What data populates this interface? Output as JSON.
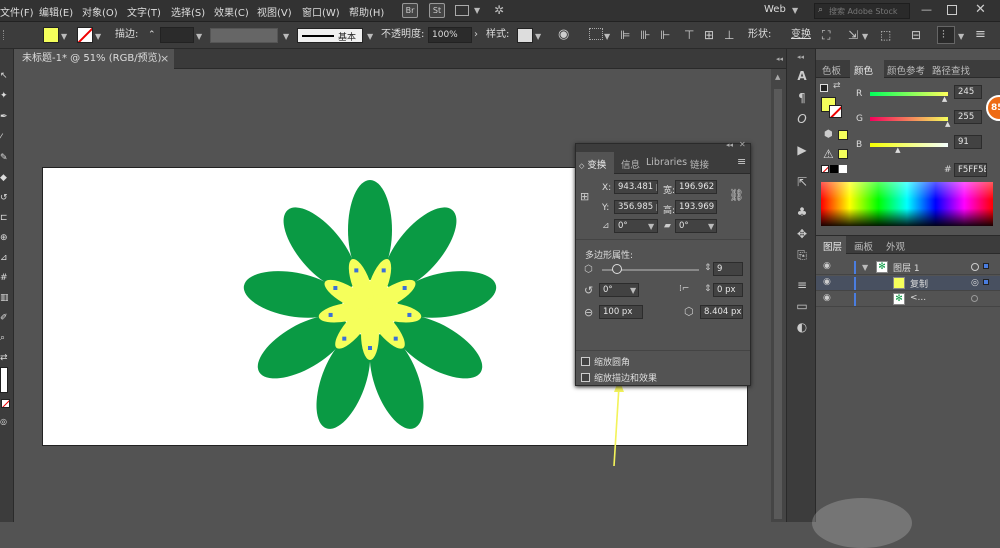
{
  "menubar": {
    "items": [
      "文件(F)",
      "编辑(E)",
      "对象(O)",
      "文字(T)",
      "选择(S)",
      "效果(C)",
      "视图(V)",
      "窗口(W)",
      "帮助(H)"
    ],
    "bridge": "Br",
    "stock": "St",
    "workspace": "Web",
    "search_placeholder": "搜索 Adobe Stock"
  },
  "control": {
    "stroke_label": "描边:",
    "stroke_style": "基本",
    "opacity_label": "不透明度:",
    "opacity_value": "100%",
    "style_label": "样式:",
    "shape_label": "形状:",
    "transform_label": "变换",
    "fill_color": "#F5FF5B"
  },
  "document": {
    "tab_title": "未标题-1* @ 51% (RGB/预览)",
    "close": "×"
  },
  "transform_panel": {
    "tabs": [
      "变换",
      "信息",
      "Libraries",
      "链接"
    ],
    "x_label": "X:",
    "x_value": "943.481 p",
    "w_label": "宽:",
    "w_value": "196.962 p",
    "y_label": "Y:",
    "y_value": "356.985 p",
    "h_label": "高:",
    "h_value": "193.969 p",
    "rotate_value": "0°",
    "shear_value": "0°",
    "polygon_label": "多边形属性:",
    "sides_value": "9",
    "sides_fraction": 0.15,
    "angle_value": "0°",
    "corner_value": "0 px",
    "radius_value": "100 px",
    "side_length_value": "8.404 px",
    "scale_corners": "缩放圆角",
    "scale_strokes": "缩放描边和效果"
  },
  "color_panel": {
    "tabs": [
      "色板",
      "颜色",
      "颜色参考",
      "路径查找"
    ],
    "r_label": "R",
    "r_value": "245",
    "r_fraction": 0.96,
    "g_label": "G",
    "g_value": "255",
    "g_fraction": 1.0,
    "b_label": "B",
    "b_value": "91",
    "b_fraction": 0.36,
    "hex_label": "#",
    "hex_value": "F5FF5B",
    "fill_color": "#F5FF5B",
    "badge_text": "85"
  },
  "layers_panel": {
    "tabs": [
      "图层",
      "画板",
      "外观"
    ],
    "rows": [
      {
        "name": "图层 1"
      },
      {
        "name": "复制"
      },
      {
        "name": "<..."
      }
    ]
  },
  "colors": {
    "petal_green": "#0a9a44",
    "petal_yellow": "#f5ff5b",
    "arrow_yellow": "#f3f35a"
  }
}
